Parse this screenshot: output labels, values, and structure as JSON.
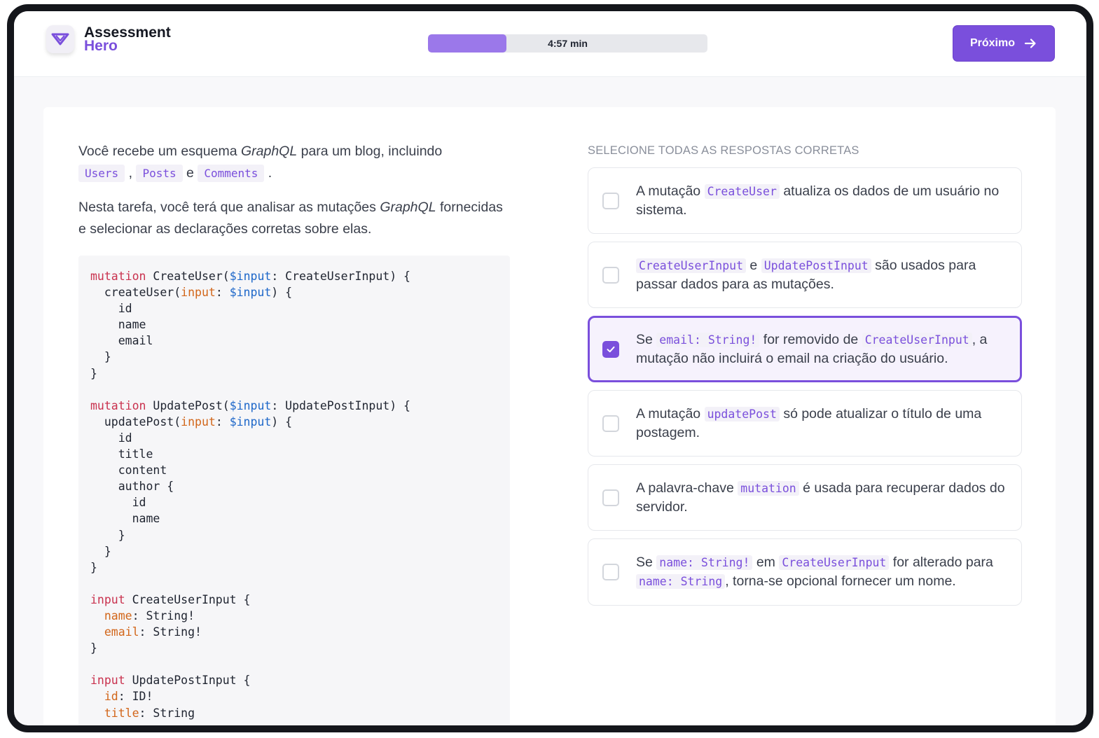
{
  "app": {
    "name_line1": "Assessment",
    "name_line2": "Hero",
    "brand_color": "#7a4fdc"
  },
  "header": {
    "timer": "4:57 min",
    "progress_fraction": 0.28,
    "next_label": "Próximo"
  },
  "question": {
    "p1_a": "Você recebe um esquema ",
    "p1_em": "GraphQL",
    "p1_b": " para um blog, incluindo",
    "code_users": "Users",
    "sep_comma": ",",
    "code_posts": "Posts",
    "sep_e": "e",
    "code_comments": "Comments",
    "sep_dot": ".",
    "p2_a": "Nesta tarefa, você terá que analisar as mutações ",
    "p2_em": "GraphQL",
    "p2_b": " fornecidas e selecionar as declarações corretas sobre elas."
  },
  "code_lines": [
    [
      [
        "kw",
        "mutation"
      ],
      [
        "t",
        " CreateUser("
      ],
      [
        "vr",
        "$input"
      ],
      [
        "t",
        ": CreateUserInput) {"
      ]
    ],
    [
      [
        "t",
        "  createUser("
      ],
      [
        "ar",
        "input"
      ],
      [
        "t",
        ": "
      ],
      [
        "vr",
        "$input"
      ],
      [
        "t",
        ") {"
      ]
    ],
    [
      [
        "t",
        "    id"
      ]
    ],
    [
      [
        "t",
        "    name"
      ]
    ],
    [
      [
        "t",
        "    email"
      ]
    ],
    [
      [
        "t",
        "  }"
      ]
    ],
    [
      [
        "t",
        "}"
      ]
    ],
    [
      [
        "t",
        ""
      ]
    ],
    [
      [
        "kw",
        "mutation"
      ],
      [
        "t",
        " UpdatePost("
      ],
      [
        "vr",
        "$input"
      ],
      [
        "t",
        ": UpdatePostInput) {"
      ]
    ],
    [
      [
        "t",
        "  updatePost("
      ],
      [
        "ar",
        "input"
      ],
      [
        "t",
        ": "
      ],
      [
        "vr",
        "$input"
      ],
      [
        "t",
        ") {"
      ]
    ],
    [
      [
        "t",
        "    id"
      ]
    ],
    [
      [
        "t",
        "    title"
      ]
    ],
    [
      [
        "t",
        "    content"
      ]
    ],
    [
      [
        "t",
        "    author {"
      ]
    ],
    [
      [
        "t",
        "      id"
      ]
    ],
    [
      [
        "t",
        "      name"
      ]
    ],
    [
      [
        "t",
        "    }"
      ]
    ],
    [
      [
        "t",
        "  }"
      ]
    ],
    [
      [
        "t",
        "}"
      ]
    ],
    [
      [
        "t",
        ""
      ]
    ],
    [
      [
        "kw",
        "input"
      ],
      [
        "t",
        " CreateUserInput {"
      ]
    ],
    [
      [
        "t",
        "  "
      ],
      [
        "ar",
        "name"
      ],
      [
        "t",
        ": String!"
      ]
    ],
    [
      [
        "t",
        "  "
      ],
      [
        "ar",
        "email"
      ],
      [
        "t",
        ": String!"
      ]
    ],
    [
      [
        "t",
        "}"
      ]
    ],
    [
      [
        "t",
        ""
      ]
    ],
    [
      [
        "kw",
        "input"
      ],
      [
        "t",
        " UpdatePostInput {"
      ]
    ],
    [
      [
        "t",
        "  "
      ],
      [
        "ar",
        "id"
      ],
      [
        "t",
        ": ID!"
      ]
    ],
    [
      [
        "t",
        "  "
      ],
      [
        "ar",
        "title"
      ],
      [
        "t",
        ": String"
      ]
    ]
  ],
  "answers": {
    "instruction": "SELECIONE TODAS AS RESPOSTAS CORRETAS",
    "options": [
      {
        "selected": false,
        "parts": [
          [
            "t",
            "A mutação "
          ],
          [
            "c",
            "CreateUser"
          ],
          [
            "t",
            " atualiza os dados de um usuário no sistema."
          ]
        ]
      },
      {
        "selected": false,
        "parts": [
          [
            "c",
            "CreateUserInput"
          ],
          [
            "t",
            " e "
          ],
          [
            "c",
            "UpdatePostInput"
          ],
          [
            "t",
            " são usados para passar dados para as mutações."
          ]
        ]
      },
      {
        "selected": true,
        "parts": [
          [
            "t",
            "Se "
          ],
          [
            "c",
            "email: String!"
          ],
          [
            "t",
            " for removido de "
          ],
          [
            "c",
            "CreateUserInput"
          ],
          [
            "t",
            ", a mutação não incluirá o email na criação do usuário."
          ]
        ]
      },
      {
        "selected": false,
        "parts": [
          [
            "t",
            "A mutação "
          ],
          [
            "c",
            "updatePost"
          ],
          [
            "t",
            " só pode atualizar o título de uma postagem."
          ]
        ]
      },
      {
        "selected": false,
        "parts": [
          [
            "t",
            "A palavra-chave "
          ],
          [
            "c",
            "mutation"
          ],
          [
            "t",
            " é usada para recuperar dados do servidor."
          ]
        ]
      },
      {
        "selected": false,
        "parts": [
          [
            "t",
            "Se "
          ],
          [
            "c",
            "name: String!"
          ],
          [
            "t",
            " em "
          ],
          [
            "c",
            "CreateUserInput"
          ],
          [
            "t",
            " for alterado para "
          ],
          [
            "c",
            "name: String"
          ],
          [
            "t",
            ", torna-se opcional fornecer um nome."
          ]
        ]
      }
    ]
  }
}
